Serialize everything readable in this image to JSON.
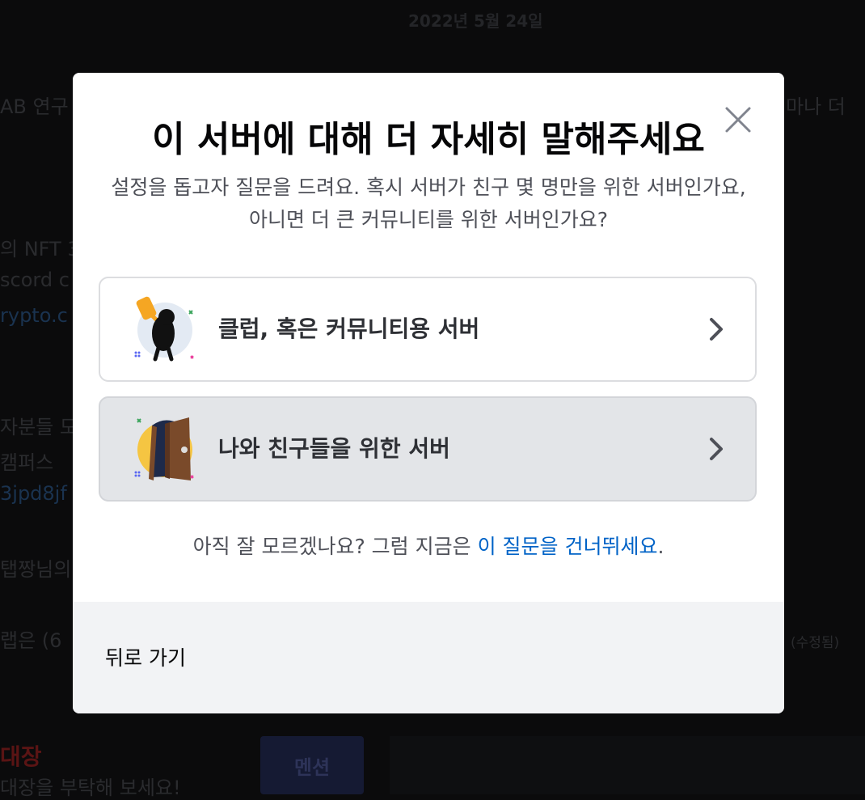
{
  "background": {
    "date": "2022년 5월 24일",
    "fragments": [
      {
        "name": "bg-fragment-1",
        "text": "AB 연구"
      },
      {
        "name": "bg-fragment-2",
        "text": "마나 더"
      },
      {
        "name": "bg-fragment-3",
        "text": "의 NFT 3"
      },
      {
        "name": "bg-fragment-4",
        "text": "scord c"
      },
      {
        "name": "bg-fragment-5",
        "text": "rypto.c"
      },
      {
        "name": "bg-fragment-6",
        "text": "자분들 모"
      },
      {
        "name": "bg-fragment-7",
        "text": "캠퍼스"
      },
      {
        "name": "bg-fragment-8",
        "text": "3jpd8jf"
      },
      {
        "name": "bg-fragment-9",
        "text": "탭짱님의"
      },
      {
        "name": "bg-fragment-10",
        "text": "랩은 (6"
      },
      {
        "name": "bg-fragment-11",
        "text": "(수정됨)"
      },
      {
        "name": "bg-fragment-12",
        "text": "대장"
      },
      {
        "name": "bg-fragment-13",
        "text": "대장을 부탁해 보세요!"
      }
    ],
    "mention_label": "멘션"
  },
  "modal": {
    "title": "이 서버에 대해 더 자세히 말해주세요",
    "subtitle": "설정을 돕고자 질문을 드려요. 혹시 서버가 친구 몇 명만을 위한 서버인가요, 아니면 더 큰 커뮤니티를 위한 서버인가요?",
    "options": [
      {
        "label": "클럽, 혹은 커뮤니티용 서버",
        "icon": "club-community-illustration-icon"
      },
      {
        "label": "나와 친구들을 위한 서버",
        "icon": "friends-door-illustration-icon"
      }
    ],
    "hint_prefix": "아직 잘 모르겠나요? 그럼 지금은 ",
    "hint_link": "이 질문을 건너뛰세요",
    "hint_suffix": ".",
    "back_label": "뒤로 가기",
    "close_icon": "close-icon"
  },
  "colors": {
    "accent_link": "#0063c7",
    "title": "#060607",
    "muted_text": "#4e5058",
    "footer_bg": "#f2f3f5",
    "selected_option_bg": "#e3e5e8"
  }
}
